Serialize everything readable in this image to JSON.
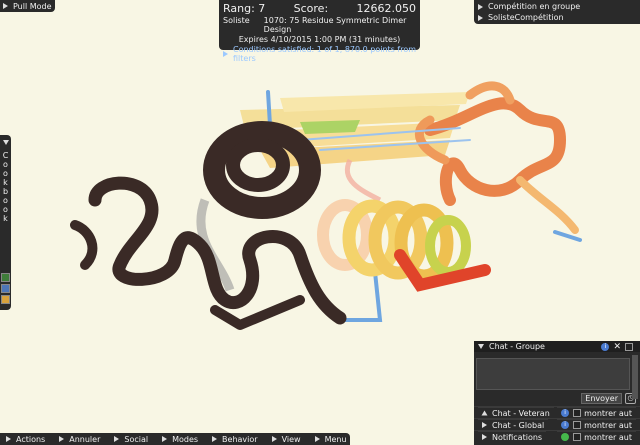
{
  "pull_mode": {
    "label": "Pull Mode"
  },
  "score_panel": {
    "rank_label": "Rang: 7",
    "score_label": "Score:",
    "score_value": "12662.050",
    "mode": "Soliste",
    "puzzle": "1070: 75 Residue Symmetric Dimer Design",
    "expires": "Expires 4/10/2015 1:00 PM (31 minutes)",
    "conditions": "Conditions satisfied: 1 of 1, 870.0 points from filters"
  },
  "groups_panel": {
    "items": [
      "Compétition en groupe",
      "SolisteCompétition"
    ]
  },
  "cookbook": {
    "letters": [
      "C",
      "o",
      "o",
      "k",
      "b",
      "o",
      "o",
      "k"
    ]
  },
  "bottom_bar": {
    "items": [
      "Actions",
      "Annuler",
      "Social",
      "Modes",
      "Behavior",
      "View",
      "Menu"
    ]
  },
  "chat": {
    "header": "Chat - Groupe",
    "send_label": "Envoyer",
    "channels": [
      {
        "name": "Chat - Veteran",
        "toggle": "montrer aut"
      },
      {
        "name": "Chat - Global",
        "toggle": "montrer aut"
      },
      {
        "name": "Notifications",
        "toggle": "montrer aut"
      }
    ]
  },
  "colors": {
    "background": "#f8f6e4",
    "panel": "#2a2a2a",
    "link_blue": "#9cc9ff",
    "dark_chain": "#3a2a26",
    "orange_chain": "#e9834a",
    "helix_yellow": "#f4d36b",
    "helix_red": "#e0442a"
  }
}
